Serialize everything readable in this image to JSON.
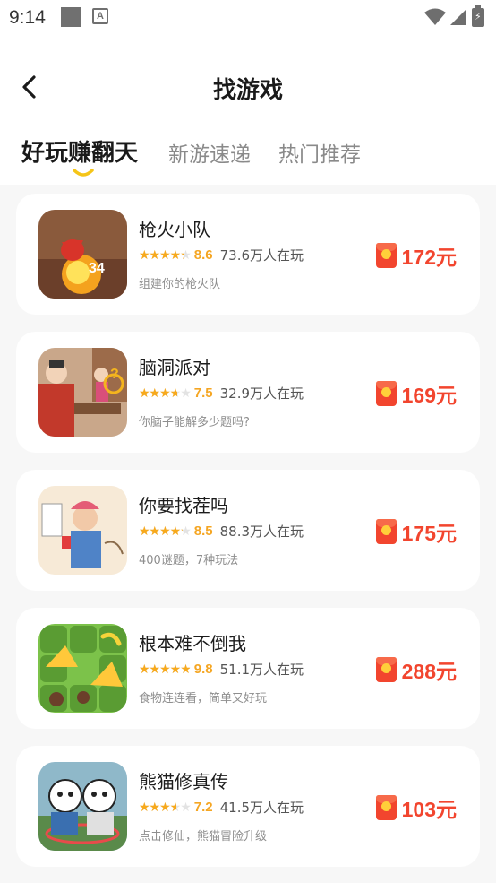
{
  "status_bar": {
    "time": "9:14",
    "notification_icons": [
      "square-icon",
      "a-icon"
    ],
    "system_icons": [
      "wifi-icon",
      "signal-icon",
      "battery-charging-icon"
    ]
  },
  "header": {
    "title": "找游戏",
    "back_icon": "chevron-left-icon"
  },
  "tabs": [
    {
      "label": "好玩赚翻天",
      "active": true
    },
    {
      "label": "新游速递",
      "active": false
    },
    {
      "label": "热门推荐",
      "active": false
    }
  ],
  "colors": {
    "accent": "#f2452e",
    "star": "#f7a91c",
    "score": "#f5a623",
    "tab_indicator": "#f5c518"
  },
  "games": [
    {
      "name": "枪火小队",
      "rating": 8.6,
      "rating_text": "8.6",
      "players": "73.6万人在玩",
      "desc": "组建你的枪火队",
      "reward": "172元"
    },
    {
      "name": "脑洞派对",
      "rating": 7.5,
      "rating_text": "7.5",
      "players": "32.9万人在玩",
      "desc": "你脑子能解多少题吗?",
      "reward": "169元"
    },
    {
      "name": "你要找茬吗",
      "rating": 8.5,
      "rating_text": "8.5",
      "players": "88.3万人在玩",
      "desc": "400谜题，7种玩法",
      "reward": "175元"
    },
    {
      "name": "根本难不倒我",
      "rating": 9.8,
      "rating_text": "9.8",
      "players": "51.1万人在玩",
      "desc": "食物连连看，简单又好玩",
      "reward": "288元"
    },
    {
      "name": "熊猫修真传",
      "rating": 7.2,
      "rating_text": "7.2",
      "players": "41.5万人在玩",
      "desc": "点击修仙，熊猫冒险升级",
      "reward": "103元"
    }
  ]
}
